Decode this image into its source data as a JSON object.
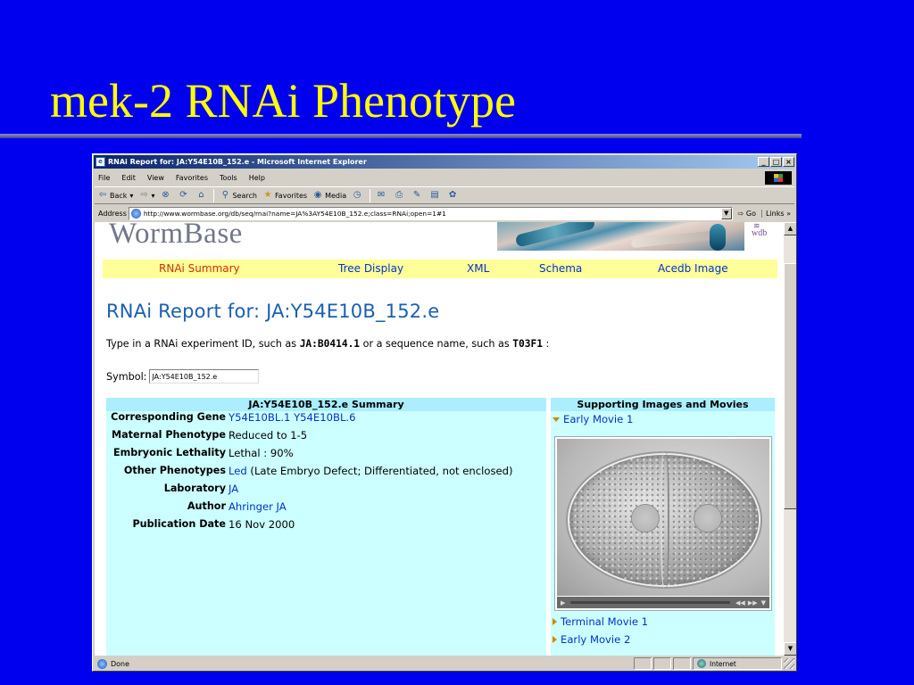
{
  "slide": {
    "title": "mek-2 RNAi Phenotype"
  },
  "browser": {
    "window_title": "RNAi Report for: JA:Y54E10B_152.e - Microsoft Internet Explorer",
    "window_buttons": {
      "minimize": "_",
      "maximize": "□",
      "close": "×"
    },
    "menu": [
      "File",
      "Edit",
      "View",
      "Favorites",
      "Tools",
      "Help"
    ],
    "toolbar": {
      "back": "Back",
      "search": "Search",
      "favorites": "Favorites",
      "media": "Media"
    },
    "address_label": "Address",
    "address_url": "http://www.wormbase.org/db/seq/rnai?name=JA%3AY54E10B_152.e;class=RNAi;open=1#1",
    "go_label": "Go",
    "links_label": "Links",
    "status_text": "Done",
    "zone_text": "Internet"
  },
  "page": {
    "logo": "WormBase",
    "banner_logo": "wdb",
    "nav": [
      {
        "label": "RNAi Summary",
        "current": true
      },
      {
        "label": "Tree Display",
        "current": false
      },
      {
        "label": "XML",
        "current": false
      },
      {
        "label": "Schema",
        "current": false
      },
      {
        "label": "Acedb Image",
        "current": false
      }
    ],
    "report_title": "RNAi Report for: JA:Y54E10B_152.e",
    "instructions": {
      "before": "Type in a RNAi experiment ID, such as ",
      "example1": "JA:B0414.1",
      "middle": " or a sequence name, such as ",
      "example2": "T03F1",
      "after": " :"
    },
    "symbol_label": "Symbol:",
    "symbol_value": "JA:Y54E10B_152.e",
    "summary": {
      "heading": "JA:Y54E10B_152.e Summary",
      "corresponding_gene_label": "Corresponding Gene",
      "corresponding_gene_values": [
        "Y54E10BL.1",
        "Y54E10BL.6"
      ],
      "maternal_phenotype_label": "Maternal Phenotype",
      "maternal_phenotype_value": "Reduced to 1-5",
      "embryonic_lethality_label": "Embryonic Lethality",
      "embryonic_lethality_value": "Lethal : 90%",
      "other_phenotypes_label": "Other Phenotypes",
      "other_phenotypes_link": "Led",
      "other_phenotypes_text": " (Late Embryo Defect; Differentiated, not enclosed)",
      "laboratory_label": "Laboratory",
      "laboratory_value": "JA",
      "author_label": "Author",
      "author_value": "Ahringer JA",
      "publication_date_label": "Publication Date",
      "publication_date_value": "16 Nov 2000"
    },
    "media": {
      "heading": "Supporting Images and Movies",
      "early_movie_1": "Early Movie 1",
      "terminal_movie_1": "Terminal Movie 1",
      "early_movie_2": "Early Movie 2"
    }
  }
}
